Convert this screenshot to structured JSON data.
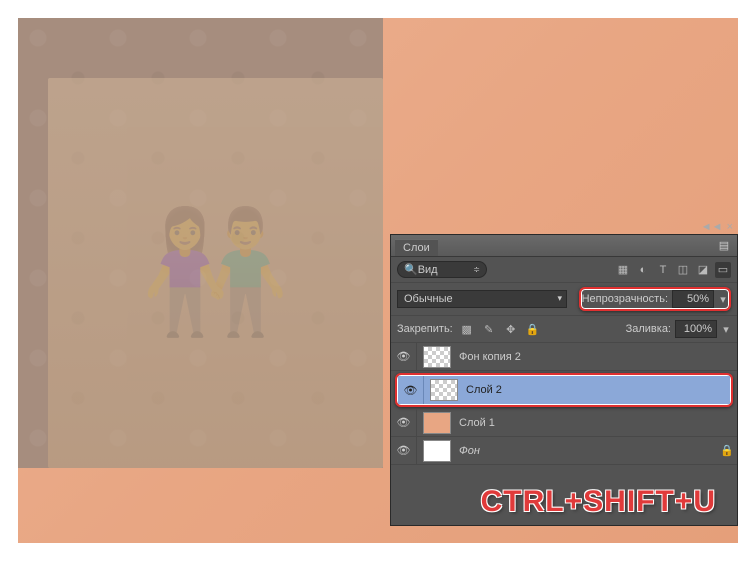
{
  "panel": {
    "title": "Слои",
    "search_label": "Вид",
    "search_placeholder": "Вид",
    "filter_icons": [
      "img",
      "fx",
      "T",
      "shape",
      "smart"
    ],
    "blend_mode": "Обычные",
    "opacity_label": "Непрозрачность:",
    "opacity_value": "50%",
    "lock_label": "Закрепить:",
    "fill_label": "Заливка:",
    "fill_value": "100%"
  },
  "layers": [
    {
      "name": "Фон копия 2",
      "selected": false,
      "thumb": "checker",
      "locked": false
    },
    {
      "name": "Слой 2",
      "selected": true,
      "thumb": "checker",
      "locked": false
    },
    {
      "name": "Слой 1",
      "selected": false,
      "thumb": "peach",
      "locked": false
    },
    {
      "name": "Фон",
      "selected": false,
      "thumb": "white",
      "locked": true,
      "italic": true
    }
  ],
  "shortcut": "CTRL+SHIFT+U"
}
